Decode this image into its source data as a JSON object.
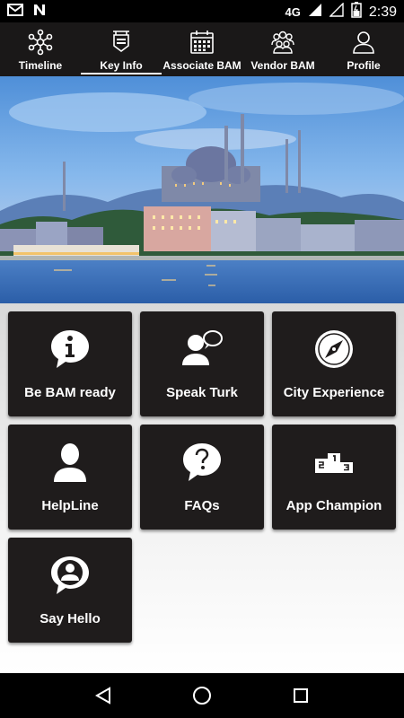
{
  "status_bar": {
    "network": "4G",
    "time": "2:39"
  },
  "tabs": [
    {
      "label": "Timeline",
      "icon": "network-icon"
    },
    {
      "label": "Key Info",
      "icon": "signboard-icon",
      "active": true
    },
    {
      "label": "Associate BAM",
      "icon": "calendar-icon"
    },
    {
      "label": "Vendor BAM",
      "icon": "group-icon"
    },
    {
      "label": "Profile",
      "icon": "person-icon"
    }
  ],
  "tiles": [
    {
      "label": "Be BAM ready",
      "icon": "info-bubble-icon"
    },
    {
      "label": "Speak Turk",
      "icon": "speaking-person-icon"
    },
    {
      "label": "City Experience",
      "icon": "compass-icon"
    },
    {
      "label": "HelpLine",
      "icon": "person-silhouette-icon"
    },
    {
      "label": "FAQs",
      "icon": "question-bubble-icon"
    },
    {
      "label": "App Champion",
      "icon": "podium-icon"
    },
    {
      "label": "Say Hello",
      "icon": "chat-person-icon"
    }
  ],
  "colors": {
    "tab_bar": "#1a1818",
    "tile": "#1f1c1c",
    "text": "#ffffff"
  }
}
